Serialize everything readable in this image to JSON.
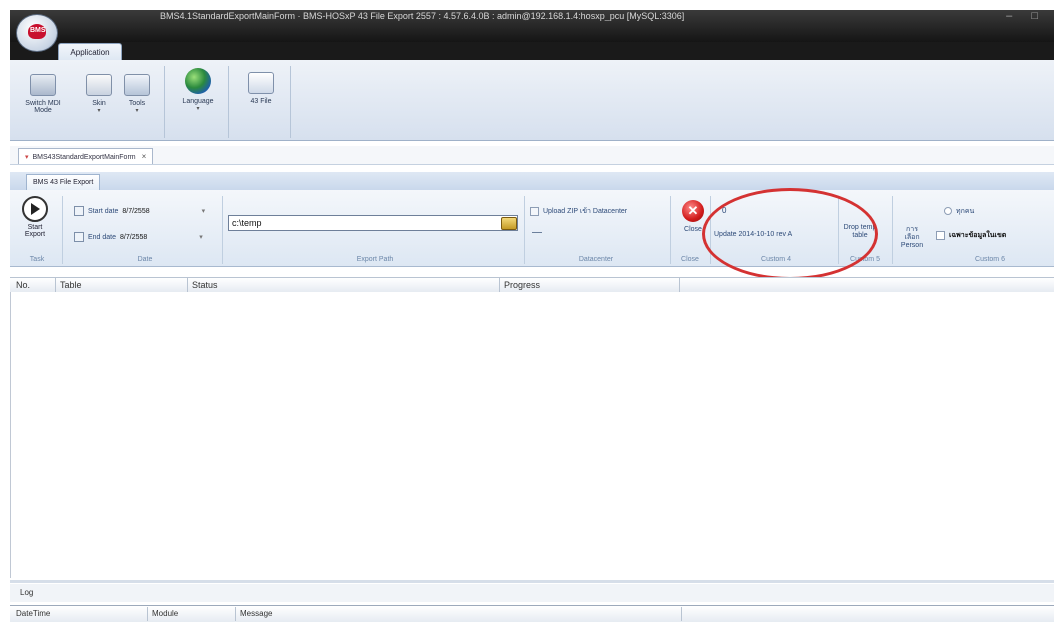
{
  "window": {
    "title": "BMS4.1StandardExportMainForm · BMS-HOSxP 43 File Export 2557 : 4.57.6.4.0B : admin@192.168.1.4:hosxp_pcu [MySQL:3306]",
    "controls": "– □"
  },
  "ribbon": {
    "tab": "Application",
    "buttons": [
      {
        "label": "Switch MDI Mode",
        "icon": "monitor-icon"
      },
      {
        "label": "Skin",
        "sub": "▾",
        "icon": "skin-icon"
      },
      {
        "label": "Tools",
        "sub": "▾",
        "icon": "tools-icon"
      },
      {
        "label": "Language",
        "sub": "▾",
        "icon": "globe-icon"
      },
      {
        "label": "43 File",
        "icon": "file-icon"
      }
    ]
  },
  "doc_tab": {
    "label": "BMS43StandardExportMainForm",
    "close": "×"
  },
  "sub_ribbon": {
    "tab": "BMS 43 File Export",
    "task": {
      "button": "Start Export",
      "group": "Task"
    },
    "date": {
      "start_label": "Start date",
      "start_value": "8/7/2558",
      "end_label": "End date",
      "end_value": "8/7/2558",
      "group": "Date"
    },
    "export_path": {
      "value": "c:\\temp",
      "group": "Export Path"
    },
    "datacenter": {
      "checkbox": "Upload ZIP เข้า Datacenter",
      "group": "Datacenter"
    },
    "close": {
      "label": "Close",
      "group": "Close"
    },
    "custom4": {
      "count": "0",
      "update": "Update 2014-10-10 rev A",
      "group": "Custom 4"
    },
    "custom5": {
      "button": "Drop temp table",
      "group": "Custom 5"
    },
    "custom6": {
      "radio": "ทุกคน",
      "person": "การเลือก Person",
      "checkbox": "เฉพาะข้อมูลในเขต",
      "group": "Custom 6"
    }
  },
  "grid": {
    "columns": [
      "No.",
      "Table",
      "Status",
      "Progress"
    ]
  },
  "log": {
    "title": "Log",
    "columns": [
      "DateTime",
      "Module",
      "Message"
    ]
  },
  "annotation_color": "#d43232"
}
